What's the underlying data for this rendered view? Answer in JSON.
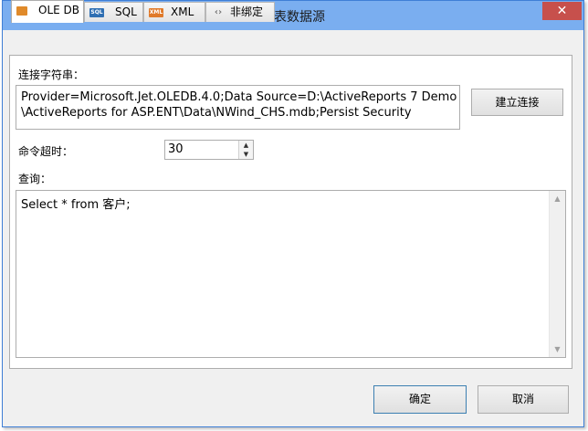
{
  "window": {
    "title": "报表数据源",
    "close_label": "✕"
  },
  "tabs": [
    {
      "label": "OLE DB",
      "icon": "oledb-icon",
      "active": true
    },
    {
      "label": "SQL",
      "icon": "sql-icon"
    },
    {
      "label": "XML",
      "icon": "xml-icon"
    },
    {
      "label": "非绑定",
      "icon": "unbound-icon"
    }
  ],
  "tab_icon_text": {
    "sql": "SQL",
    "xml": "XML"
  },
  "connection": {
    "label": "连接字符串：",
    "value": "Provider=Microsoft.Jet.OLEDB.4.0;Data Source=D:\\ActiveReports 7 Demo\n\\ActiveReports for ASP.ENT\\Data\\NWind_CHS.mdb;Persist Security",
    "build_button": "建立连接"
  },
  "timeout": {
    "label": "命令超时：",
    "value": "30",
    "up": "▲",
    "down": "▼"
  },
  "query": {
    "label": "查询：",
    "value": "Select * from 客户;",
    "scroll_up": "▲",
    "scroll_down": "▼"
  },
  "footer": {
    "ok": "确定",
    "cancel": "取消"
  },
  "colors": {
    "titlebar": "#7aaef0",
    "close": "#c7504c",
    "accent_border": "#3c7fb1"
  }
}
